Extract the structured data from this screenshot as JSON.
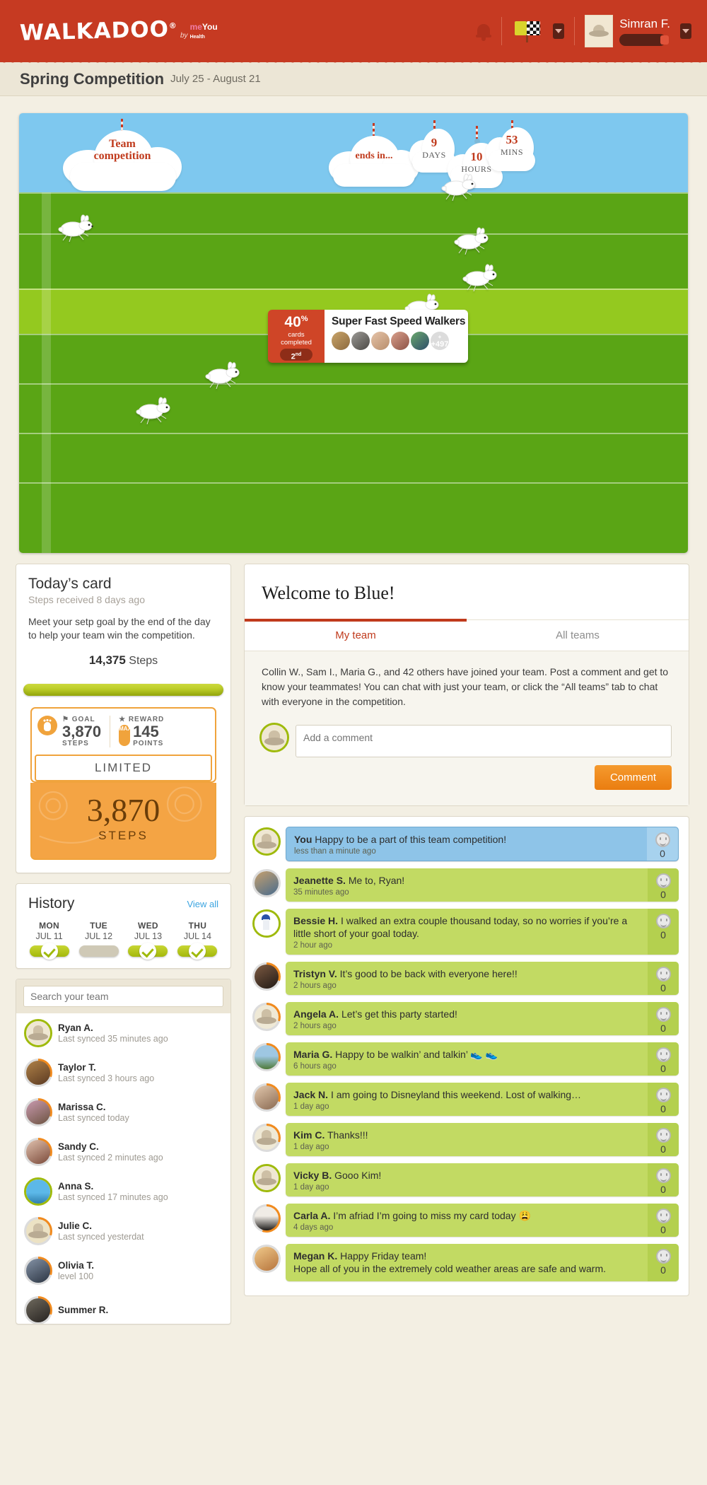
{
  "brand": {
    "name": "WALKADOO",
    "registered": "®",
    "by": "by",
    "partner": "meYou Health"
  },
  "topbar": {
    "bell_icon": "bell-icon",
    "flags_icon": "race-flags-icon",
    "flags_caret": "▼",
    "user_name": "Simran F.",
    "user_caret": "▼"
  },
  "subheader": {
    "title": "Spring Competition",
    "date_range": "July 25 - August 21"
  },
  "race": {
    "team_cloud_line1": "Team",
    "team_cloud_line2": "competition",
    "ends_in_label": "ends in...",
    "countdown": [
      {
        "value": "9",
        "unit": "DAYS"
      },
      {
        "value": "10",
        "unit": "HOURS"
      },
      {
        "value": "53",
        "unit": "MINS"
      }
    ],
    "callout": {
      "percent": "40",
      "percent_symbol": "%",
      "percent_caption_1": "cards",
      "percent_caption_2": "completed",
      "rank": "2",
      "rank_suffix": "nd",
      "team_name": "Super Fast Speed Walkers",
      "more_members": "+497"
    }
  },
  "todays_card": {
    "title": "Today’s card",
    "subtitle": "Steps received 8 days ago",
    "body": "Meet your setp goal by the end of the day to help your team win the competition.",
    "steps_value": "14,375",
    "steps_label": "Steps",
    "goal_label": "GOAL",
    "goal_value": "3,870",
    "goal_unit": "STEPS",
    "reward_label": "REWARD",
    "max_badge": "MAX",
    "reward_value": "145",
    "reward_unit": "POINTS",
    "ribbon": "LIMITED",
    "big_number": "3,870",
    "big_unit": "STEPS"
  },
  "history": {
    "title": "History",
    "view_all": "View all",
    "days": [
      {
        "name": "MON",
        "date": "JUL 11",
        "complete": true
      },
      {
        "name": "TUE",
        "date": "JUL 12",
        "complete": false
      },
      {
        "name": "WED",
        "date": "JUL 13",
        "complete": true
      },
      {
        "name": "THU",
        "date": "JUL 14",
        "complete": true
      }
    ]
  },
  "team_panel": {
    "search_placeholder": "Search your team",
    "members": [
      {
        "name": "Ryan A.",
        "status": "Last synced 35 minutes ago",
        "ring": "green",
        "art": "hat"
      },
      {
        "name": "Taylor T.",
        "status": "Last synced 3 hours ago",
        "ring": "orange",
        "art": "photo-dog"
      },
      {
        "name": "Marissa C.",
        "status": "Last synced today",
        "ring": "orange",
        "art": "photo-pink"
      },
      {
        "name": "Sandy C.",
        "status": "Last synced 2 minutes ago",
        "ring": "orange",
        "art": "photo-woman"
      },
      {
        "name": "Anna S.",
        "status": "Last synced 17 minutes ago",
        "ring": "green",
        "art": "photo-palm"
      },
      {
        "name": "Julie C.",
        "status": "Last synced yesterdat",
        "ring": "orange",
        "art": "hat"
      },
      {
        "name": "Olivia T.",
        "status": "level 100",
        "ring": "orange",
        "art": "photo-people"
      },
      {
        "name": "Summer R.",
        "status": "",
        "ring": "orange",
        "art": "photo-dark"
      }
    ]
  },
  "welcome": {
    "title": "Welcome to Blue!",
    "tabs": [
      {
        "label": "My team",
        "active": true
      },
      {
        "label": "All teams",
        "active": false
      }
    ],
    "intro": "Collin W., Sam I., Maria G., and 42 others have joined your team. Post a comment and get to know your teammates! You can chat with just your team, or click the “All teams” tab to chat with everyone in the competition.",
    "comment_placeholder": "Add a comment",
    "comment_button": "Comment"
  },
  "comments": [
    {
      "author": "You",
      "text": "Happy to be a part of this team competition!",
      "time": "less than a minute ago",
      "likes": "0",
      "tone": "blue",
      "ring": "green",
      "art": "hat"
    },
    {
      "author": "Jeanette S.",
      "text": "Me to, Ryan!",
      "time": "35 minutes ago",
      "likes": "0",
      "tone": "green",
      "ring": "grey",
      "art": "photo-beach"
    },
    {
      "author": "Bessie H.",
      "text": "I walked an extra couple thousand today, so no worries if you’re a little short of your goal today.",
      "time": "2 hour ago",
      "likes": "0",
      "tone": "green",
      "ring": "green",
      "art": "photo-baseball"
    },
    {
      "author": "Tristyn V.",
      "text": "It’s good to be back with everyone here!!",
      "time": "2 hours ago",
      "likes": "0",
      "tone": "green",
      "ring": "orange",
      "art": "photo-dark"
    },
    {
      "author": "Angela A.",
      "text": "Let’s get this party started!",
      "time": "2 hours ago",
      "likes": "0",
      "tone": "green",
      "ring": "orange",
      "art": "hat"
    },
    {
      "author": "Maria G.",
      "text": "Happy to be walkin’ and talkin’ 👟 👟",
      "time": "6 hours ago",
      "likes": "0",
      "tone": "green",
      "ring": "orange",
      "art": "photo-field"
    },
    {
      "author": "Jack N.",
      "text": "I am going to Disneyland this weekend. Lost of walking…",
      "time": "1 day ago",
      "likes": "0",
      "tone": "green",
      "ring": "orange",
      "art": "photo-face"
    },
    {
      "author": "Kim C.",
      "text": "Thanks!!!",
      "time": "1 day ago",
      "likes": "0",
      "tone": "green",
      "ring": "orange",
      "art": "hat"
    },
    {
      "author": "Vicky B.",
      "text": "Gooo Kim!",
      "time": "1 day ago",
      "likes": "0",
      "tone": "green",
      "ring": "green",
      "art": "hat"
    },
    {
      "author": "Carla A.",
      "text": "I’m afriad I’m going to miss my card today 😩",
      "time": "4 days ago",
      "likes": "0",
      "tone": "green",
      "ring": "orange",
      "art": "photo-tux"
    },
    {
      "author": "Megan K.",
      "text": "Happy Friday team!\nHope all of you in the extremely cold weather areas are safe and warm.",
      "time": "",
      "likes": "0",
      "tone": "green",
      "ring": "grey",
      "art": "photo-gold"
    }
  ],
  "colors": {
    "brand_red": "#c63a22",
    "accent_orange": "#f08a1e",
    "grass_green": "#5aa515",
    "lane_light": "#94c91f",
    "sky_blue": "#7ec8ef",
    "bubble_green": "#c2da63",
    "bubble_blue": "#8ec4e8",
    "card_orange": "#f4a444"
  }
}
